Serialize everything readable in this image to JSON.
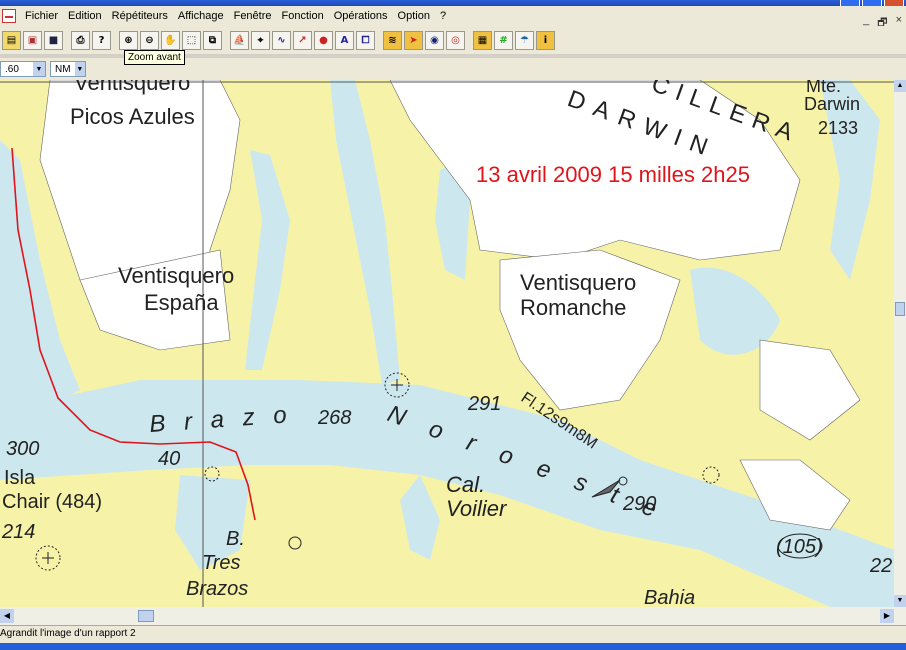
{
  "menu": {
    "items": [
      "Fichier",
      "Edition",
      "Répétiteurs",
      "Affichage",
      "Fenêtre",
      "Fonction",
      "Opérations",
      "Option",
      "?"
    ],
    "mdi_controls": [
      "_",
      "🗗",
      "×"
    ]
  },
  "toolbar": {
    "tooltip": "Zoom avant",
    "buttons": [
      "open-icon",
      "print-setup-icon",
      "save-icon",
      "print-icon",
      "help-icon",
      "zoom-in-icon",
      "zoom-out-icon",
      "pan-hand-icon",
      "select-rect-icon",
      "copy-region-icon",
      "boat-icon",
      "waypoint-icon",
      "route-icon",
      "track-icon",
      "mark-icon",
      "text-icon",
      "layers-icon",
      "tide-icon",
      "current-icon",
      "compass-icon",
      "lifebuoy-icon",
      "chart-icon",
      "grid-icon",
      "weather-icon",
      "info-icon"
    ]
  },
  "selectors": {
    "scale_value": ".60",
    "unit_value": "NM"
  },
  "map": {
    "annotation": "13 avril 2009 15 milles 2h25",
    "labels": {
      "cordillera": "DARWIN",
      "cordillera2": "CILLERA",
      "mt_name": "Mte.",
      "mt_name2": "Darwin",
      "mt_height": "2133",
      "v1a": "Ventisquero",
      "v1b": "Picos Azules",
      "v2a": "Ventisquero",
      "v2b": "España",
      "v3a": "Ventisquero",
      "v3b": "Romanche",
      "brazo": "B r a z o",
      "noroeste": "N o r o e s t e",
      "light": "Fl.12s9m8M",
      "cal1": "Cal.",
      "cal2": "Voilier",
      "btres1": "B.",
      "btres2": "Tres",
      "btres3": "Brazos",
      "isla": "Isla",
      "chair": "Chair (484)",
      "bahia": "Bahia",
      "d300": "300",
      "d40": "40",
      "d268": "268",
      "d291": "291",
      "d290": "290",
      "d105": "(105)",
      "d214": "214",
      "d22": "22"
    }
  },
  "statusbar": {
    "text": "Agrandit l'image d'un rapport 2"
  },
  "colors": {
    "land": "#f6f3a8",
    "water": "#cde7ef",
    "glacier": "#ffffff",
    "track": "#e0141a",
    "annotation": "#e0141a"
  }
}
